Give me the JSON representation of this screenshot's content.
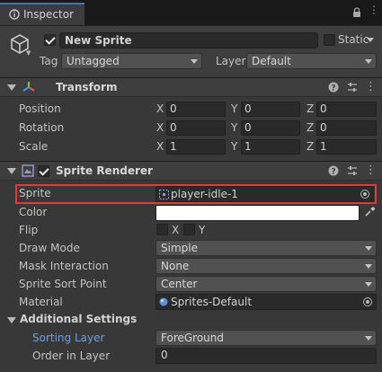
{
  "tabs": {
    "inspector_label": "Inspector"
  },
  "object": {
    "name": "New Sprite",
    "static_label": "Static",
    "tag_label": "Tag",
    "tag_value": "Untagged",
    "layer_label": "Layer",
    "layer_value": "Default"
  },
  "transform": {
    "title": "Transform",
    "position": {
      "label": "Position",
      "x": "0",
      "y": "0",
      "z": "0"
    },
    "rotation": {
      "label": "Rotation",
      "x": "0",
      "y": "0",
      "z": "0"
    },
    "scale": {
      "label": "Scale",
      "x": "1",
      "y": "1",
      "z": "1"
    }
  },
  "axes": {
    "x": "X",
    "y": "Y",
    "z": "Z"
  },
  "sprite_renderer": {
    "title": "Sprite Renderer",
    "sprite_label": "Sprite",
    "sprite_value": "player-idle-1",
    "color_label": "Color",
    "color_value": "#ffffff",
    "flip_label": "Flip",
    "flip_x": "X",
    "flip_y": "Y",
    "draw_mode_label": "Draw Mode",
    "draw_mode_value": "Simple",
    "mask_label": "Mask Interaction",
    "mask_value": "None",
    "sort_point_label": "Sprite Sort Point",
    "sort_point_value": "Center",
    "material_label": "Material",
    "material_value": "Sprites-Default",
    "additional_label": "Additional Settings",
    "sorting_layer_label": "Sorting Layer",
    "sorting_layer_value": "ForeGround",
    "order_label": "Order in Layer",
    "order_value": "0"
  },
  "icons": [
    "inspector-icon",
    "lock-icon",
    "menu-icon",
    "gameobject-cube-icon",
    "transform-icon",
    "help-icon",
    "presets-icon",
    "more-icon",
    "sprite-renderer-icon",
    "eyedropper-icon",
    "object-picker-icon",
    "material-icon",
    "sprite-asset-icon"
  ],
  "colors": {
    "highlight": "#e03c3c",
    "link": "#6f9fdc",
    "tab_accent": "#3a79bb"
  }
}
